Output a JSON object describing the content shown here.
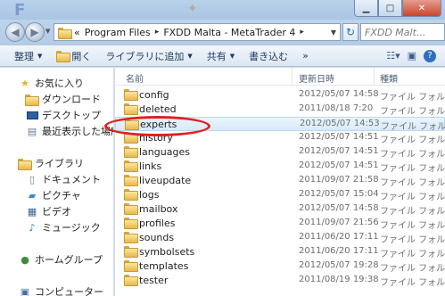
{
  "window": {
    "address": {
      "overflow": "«",
      "segments": [
        "Program Files",
        "FXDD Malta - MetaTrader 4"
      ],
      "separator": "▸"
    },
    "search_placeholder": "FXDD Malt..."
  },
  "toolbar": {
    "organize": "整理",
    "open": "開く",
    "add_to_library": "ライブラリに追加",
    "share": "共有",
    "burn": "書き込む",
    "more": "»"
  },
  "navpane": {
    "favorites": "お気に入り",
    "downloads": "ダウンロード",
    "desktop": "デスクトップ",
    "recent": "最近表示した場所",
    "libraries": "ライブラリ",
    "documents": "ドキュメント",
    "pictures": "ピクチャ",
    "videos": "ビデオ",
    "music": "ミュージック",
    "homegroup": "ホームグループ",
    "computer": "コンピューター"
  },
  "columns": {
    "name": "名前",
    "date": "更新日時",
    "type": "種類"
  },
  "files": [
    {
      "name": "config",
      "date": "2012/05/07 14:58",
      "type": "ファイル フォル"
    },
    {
      "name": "deleted",
      "date": "2011/08/18 7:20",
      "type": "ファイル フォル"
    },
    {
      "name": "experts",
      "date": "2012/05/07 14:53",
      "type": "ファイル フォル"
    },
    {
      "name": "history",
      "date": "2012/05/07 14:51",
      "type": "ファイル フォル"
    },
    {
      "name": "languages",
      "date": "2012/05/07 14:51",
      "type": "ファイル フォル"
    },
    {
      "name": "links",
      "date": "2012/05/07 14:51",
      "type": "ファイル フォル"
    },
    {
      "name": "liveupdate",
      "date": "2011/09/07 21:58",
      "type": "ファイル フォル"
    },
    {
      "name": "logs",
      "date": "2012/05/07 15:04",
      "type": "ファイル フォル"
    },
    {
      "name": "mailbox",
      "date": "2012/05/07 14:58",
      "type": "ファイル フォル"
    },
    {
      "name": "profiles",
      "date": "2011/09/07 21:56",
      "type": "ファイル フォル"
    },
    {
      "name": "sounds",
      "date": "2011/06/20 17:11",
      "type": "ファイル フォル"
    },
    {
      "name": "symbolsets",
      "date": "2011/06/20 17:11",
      "type": "ファイル フォル"
    },
    {
      "name": "templates",
      "date": "2012/05/07 19:28",
      "type": "ファイル フォル"
    },
    {
      "name": "tester",
      "date": "2011/08/19 19:38",
      "type": "ファイル フォル"
    }
  ],
  "highlight_color": "#e12020",
  "selected_file_index": 2
}
